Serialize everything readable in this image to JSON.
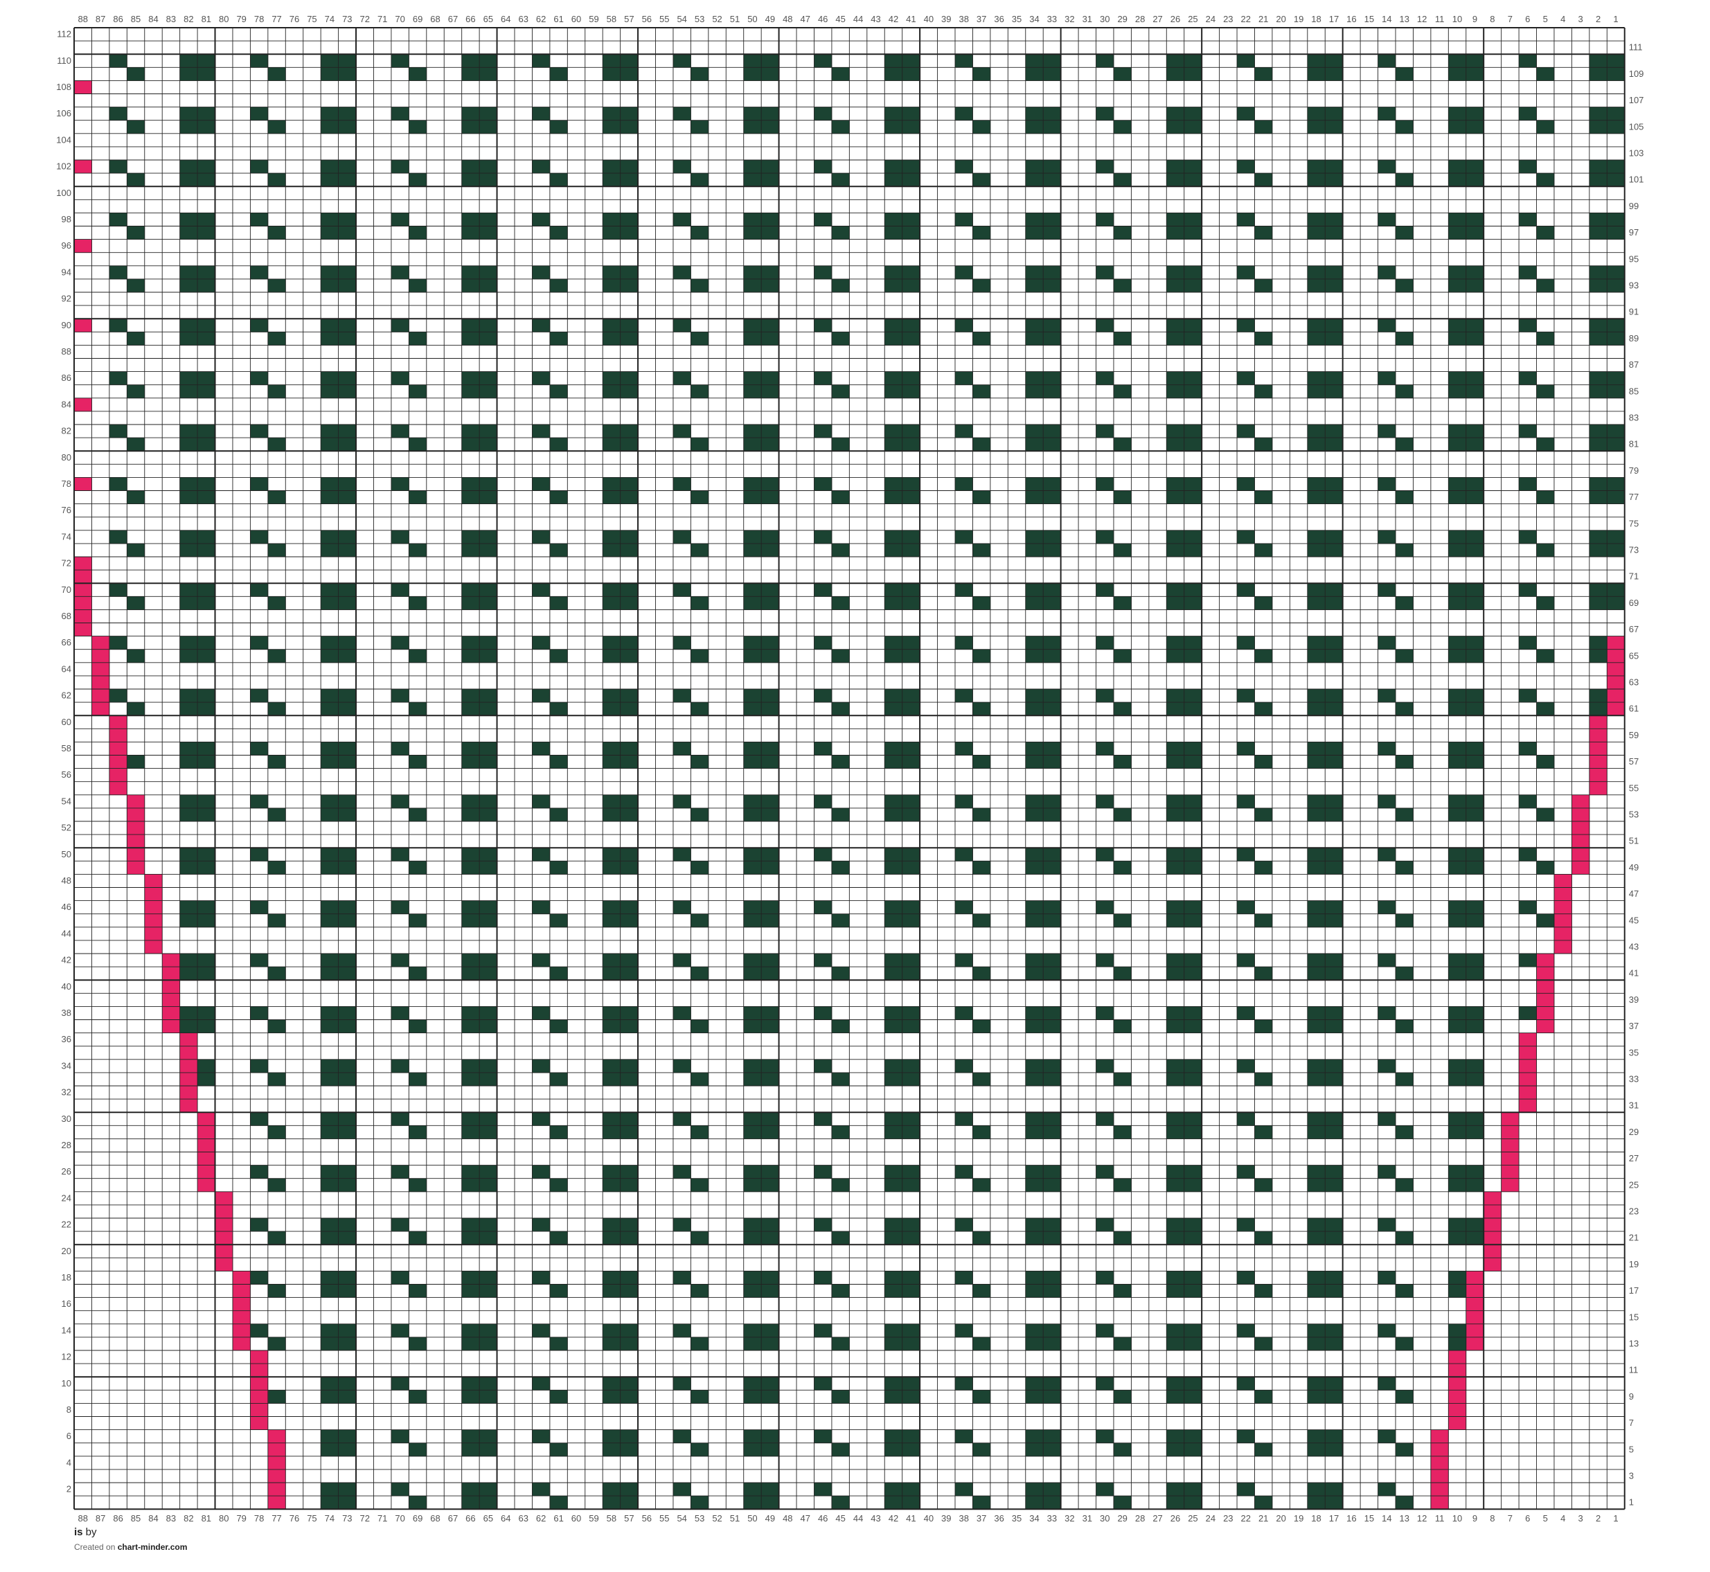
{
  "chart": {
    "columns": 88,
    "rows": 112,
    "column_numbering": "right-to-left",
    "row_number_sides": {
      "even": "left",
      "odd": "right"
    },
    "colors": {
      "background": "#ffffff",
      "grid_line": "#222222",
      "main_color": "#1b4332",
      "contrast_color": "#e62365"
    },
    "motif": {
      "description_of_shape": "knitting stitch chart, repeat of 8 columns",
      "repeat_columns": 8,
      "block_columns_in_repeat": [
        1,
        2
      ],
      "diagonal_columns_in_repeat": [
        5,
        6
      ],
      "row_period": 4
    },
    "contrast_edge_left": [
      {
        "rows": [
          1,
          6
        ],
        "column": 77
      },
      {
        "rows": [
          7,
          12
        ],
        "column": 78
      },
      {
        "rows": [
          13,
          18
        ],
        "column": 79
      },
      {
        "rows": [
          19,
          24
        ],
        "column": 80
      },
      {
        "rows": [
          25,
          30
        ],
        "column": 81
      },
      {
        "rows": [
          31,
          36
        ],
        "column": 82
      },
      {
        "rows": [
          37,
          42
        ],
        "column": 83
      },
      {
        "rows": [
          43,
          48
        ],
        "column": 84
      },
      {
        "rows": [
          49,
          54
        ],
        "column": 85
      },
      {
        "rows": [
          55,
          60
        ],
        "column": 86
      },
      {
        "rows": [
          61,
          66
        ],
        "column": 87
      },
      {
        "rows": [
          67,
          72
        ],
        "column": 88
      }
    ],
    "contrast_edge_right": [
      {
        "rows": [
          1,
          6
        ],
        "column": 11
      },
      {
        "rows": [
          7,
          12
        ],
        "column": 10
      },
      {
        "rows": [
          13,
          18
        ],
        "column": 9
      },
      {
        "rows": [
          19,
          24
        ],
        "column": 8
      },
      {
        "rows": [
          25,
          30
        ],
        "column": 7
      },
      {
        "rows": [
          31,
          36
        ],
        "column": 6
      },
      {
        "rows": [
          37,
          42
        ],
        "column": 5
      },
      {
        "rows": [
          43,
          48
        ],
        "column": 4
      },
      {
        "rows": [
          49,
          54
        ],
        "column": 3
      },
      {
        "rows": [
          55,
          60
        ],
        "column": 2
      },
      {
        "rows": [
          61,
          66
        ],
        "column": 1
      }
    ],
    "contrast_marker_rows_col88": [
      78,
      84,
      90,
      96,
      102,
      108
    ]
  },
  "footer": {
    "title_bold": "is",
    "title_rest": " by",
    "credit_prefix": "Created on ",
    "credit_site": "chart-minder.com"
  }
}
